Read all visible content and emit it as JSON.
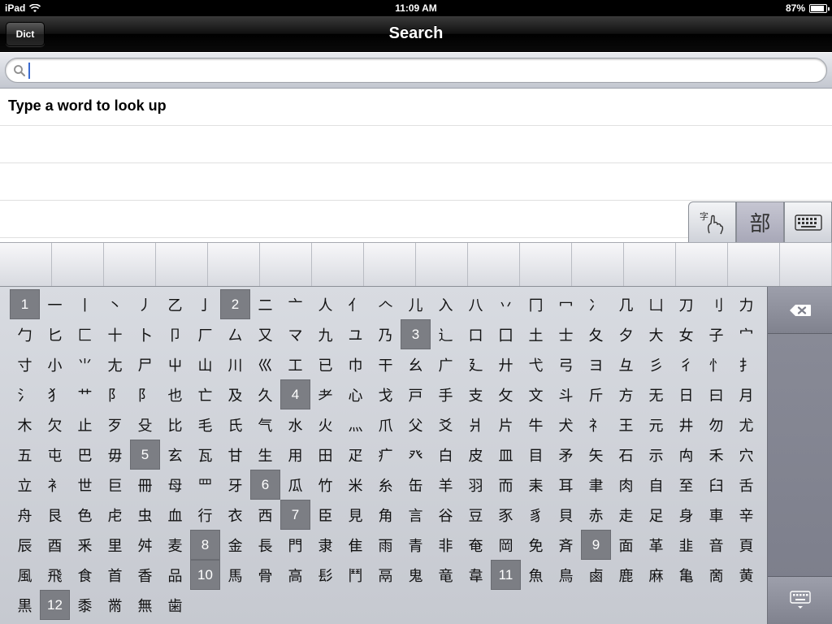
{
  "status_bar": {
    "carrier": "iPad",
    "time": "11:09 AM",
    "battery": "87%",
    "battery_level": 0.87
  },
  "nav_bar": {
    "title": "Search",
    "back_label": "Dict"
  },
  "search": {
    "value": "",
    "placeholder": ""
  },
  "results": {
    "message": "Type a word to look up"
  },
  "mode_tabs": [
    {
      "name": "handwriting",
      "icon": "handwriting-icon",
      "active": false
    },
    {
      "name": "radical",
      "glyph": "部",
      "active": true
    },
    {
      "name": "keyboard",
      "icon": "keyboard-icon",
      "active": false
    }
  ],
  "radicals": [
    "1",
    "一",
    "丨",
    "丶",
    "丿",
    "乙",
    "亅",
    "2",
    "二",
    "亠",
    "人",
    "亻",
    "𠆢",
    "儿",
    "入",
    "八",
    "丷",
    "冂",
    "冖",
    "冫",
    "几",
    "凵",
    "刀",
    "刂",
    "力",
    "勹",
    "匕",
    "匚",
    "十",
    "卜",
    "卩",
    "厂",
    "厶",
    "又",
    "マ",
    "九",
    "ユ",
    "乃",
    "3",
    "⻌",
    "口",
    "囗",
    "土",
    "士",
    "夂",
    "夕",
    "大",
    "女",
    "子",
    "宀",
    "寸",
    "小",
    "⺌",
    "尢",
    "尸",
    "屮",
    "山",
    "川",
    "巛",
    "工",
    "已",
    "巾",
    "干",
    "幺",
    "广",
    "廴",
    "廾",
    "弋",
    "弓",
    "ヨ",
    "彑",
    "彡",
    "彳",
    "忄",
    "扌",
    "氵",
    "犭",
    "艹",
    "阝",
    "阝",
    "也",
    "亡",
    "及",
    "久",
    "4",
    "⺹",
    "心",
    "戈",
    "戸",
    "手",
    "支",
    "攵",
    "文",
    "斗",
    "斤",
    "方",
    "无",
    "日",
    "曰",
    "月",
    "木",
    "欠",
    "止",
    "歹",
    "殳",
    "比",
    "毛",
    "氏",
    "气",
    "水",
    "火",
    "灬",
    "爪",
    "父",
    "爻",
    "爿",
    "片",
    "牛",
    "犬",
    "礻",
    "王",
    "元",
    "井",
    "勿",
    "尤",
    "五",
    "屯",
    "巴",
    "毋",
    "5",
    "玄",
    "瓦",
    "甘",
    "生",
    "用",
    "田",
    "疋",
    "疒",
    "癶",
    "白",
    "皮",
    "皿",
    "目",
    "矛",
    "矢",
    "石",
    "示",
    "禸",
    "禾",
    "穴",
    "立",
    "衤",
    "世",
    "巨",
    "冊",
    "母",
    "罒",
    "牙",
    "6",
    "瓜",
    "竹",
    "米",
    "糸",
    "缶",
    "羊",
    "羽",
    "而",
    "耒",
    "耳",
    "聿",
    "肉",
    "自",
    "至",
    "臼",
    "舌",
    "舟",
    "艮",
    "色",
    "虍",
    "虫",
    "血",
    "行",
    "衣",
    "西",
    "7",
    "臣",
    "見",
    "角",
    "言",
    "谷",
    "豆",
    "豕",
    "豸",
    "貝",
    "赤",
    "走",
    "足",
    "身",
    "車",
    "辛",
    "辰",
    "酉",
    "釆",
    "里",
    "舛",
    "麦",
    "8",
    "金",
    "長",
    "門",
    "隶",
    "隹",
    "雨",
    "青",
    "非",
    "奄",
    "岡",
    "免",
    "斉",
    "9",
    "面",
    "革",
    "韭",
    "音",
    "頁",
    "風",
    "飛",
    "食",
    "首",
    "香",
    "品",
    "10",
    "馬",
    "骨",
    "高",
    "髟",
    "鬥",
    "鬲",
    "鬼",
    "竜",
    "韋",
    "11",
    "魚",
    "鳥",
    "鹵",
    "鹿",
    "麻",
    "亀",
    "啇",
    "黄",
    "黒",
    "12",
    "黍",
    "黹",
    "無",
    "歯"
  ],
  "side_keys": {
    "backspace_icon": "backspace-icon",
    "hide_keyboard_icon": "hide-keyboard-icon"
  }
}
